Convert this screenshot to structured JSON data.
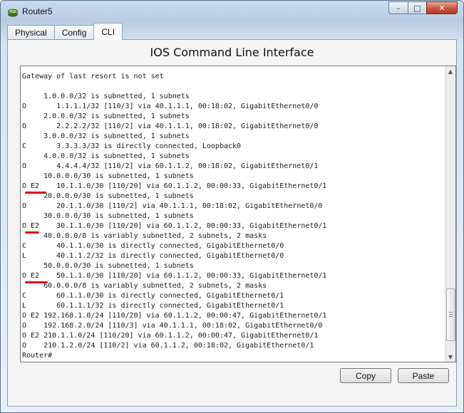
{
  "window": {
    "title": "Router5",
    "controls": {
      "minimize": "–",
      "maximize": "□",
      "close": "✕"
    }
  },
  "tabs": [
    {
      "label": "Physical",
      "active": false
    },
    {
      "label": "Config",
      "active": false
    },
    {
      "label": "CLI",
      "active": true
    }
  ],
  "cli": {
    "heading": "IOS Command Line Interface",
    "lines": [
      "Gateway of last resort is not set",
      "",
      "     1.0.0.0/32 is subnetted, 1 subnets",
      "O       1.1.1.1/32 [110/3] via 40.1.1.1, 00:18:02, GigabitEthernet0/0",
      "     2.0.0.0/32 is subnetted, 1 subnets",
      "O       2.2.2.2/32 [110/2] via 40.1.1.1, 00:18:02, GigabitEthernet0/0",
      "     3.0.0.0/32 is subnetted, 1 subnets",
      "C       3.3.3.3/32 is directly connected, Loopback0",
      "     4.0.0.0/32 is subnetted, 1 subnets",
      "O       4.4.4.4/32 [110/2] via 60.1.1.2, 00:18:02, GigabitEthernet0/1",
      "     10.0.0.0/30 is subnetted, 1 subnets",
      "O E2    10.1.1.0/30 [110/20] via 60.1.1.2, 00:00:33, GigabitEthernet0/1",
      "     20.0.0.0/30 is subnetted, 1 subnets",
      "O       20.1.1.0/30 [110/2] via 40.1.1.1, 00:18:02, GigabitEthernet0/0",
      "     30.0.0.0/30 is subnetted, 1 subnets",
      "O E2    30.1.1.0/30 [110/20] via 60.1.1.2, 00:00:33, GigabitEthernet0/1",
      "     40.0.0.0/8 is variably subnetted, 2 subnets, 2 masks",
      "C       40.1.1.0/30 is directly connected, GigabitEthernet0/0",
      "L       40.1.1.2/32 is directly connected, GigabitEthernet0/0",
      "     50.0.0.0/30 is subnetted, 1 subnets",
      "O E2    50.1.1.0/30 [110/20] via 60.1.1.2, 00:00:33, GigabitEthernet0/1",
      "     60.0.0.0/8 is variably subnetted, 2 subnets, 2 masks",
      "C       60.1.1.0/30 is directly connected, GigabitEthernet0/1",
      "L       60.1.1.1/32 is directly connected, GigabitEthernet0/1",
      "O E2 192.168.1.0/24 [110/20] via 60.1.1.2, 00:00:47, GigabitEthernet0/1",
      "O    192.168.2.0/24 [110/3] via 40.1.1.1, 00:18:02, GigabitEthernet0/0",
      "O E2 210.1.1.0/24 [110/20] via 60.1.1.2, 00:00:47, GigabitEthernet0/1",
      "O    210.1.2.0/24 [110/2] via 60.1.1.2, 00:18:02, GigabitEthernet0/1",
      "Router#"
    ]
  },
  "buttons": {
    "copy": "Copy",
    "paste": "Paste"
  },
  "annotation_color": "#d81414",
  "icons": {
    "app": "router-icon",
    "scroll_up": "▲",
    "scroll_down": "▼"
  }
}
